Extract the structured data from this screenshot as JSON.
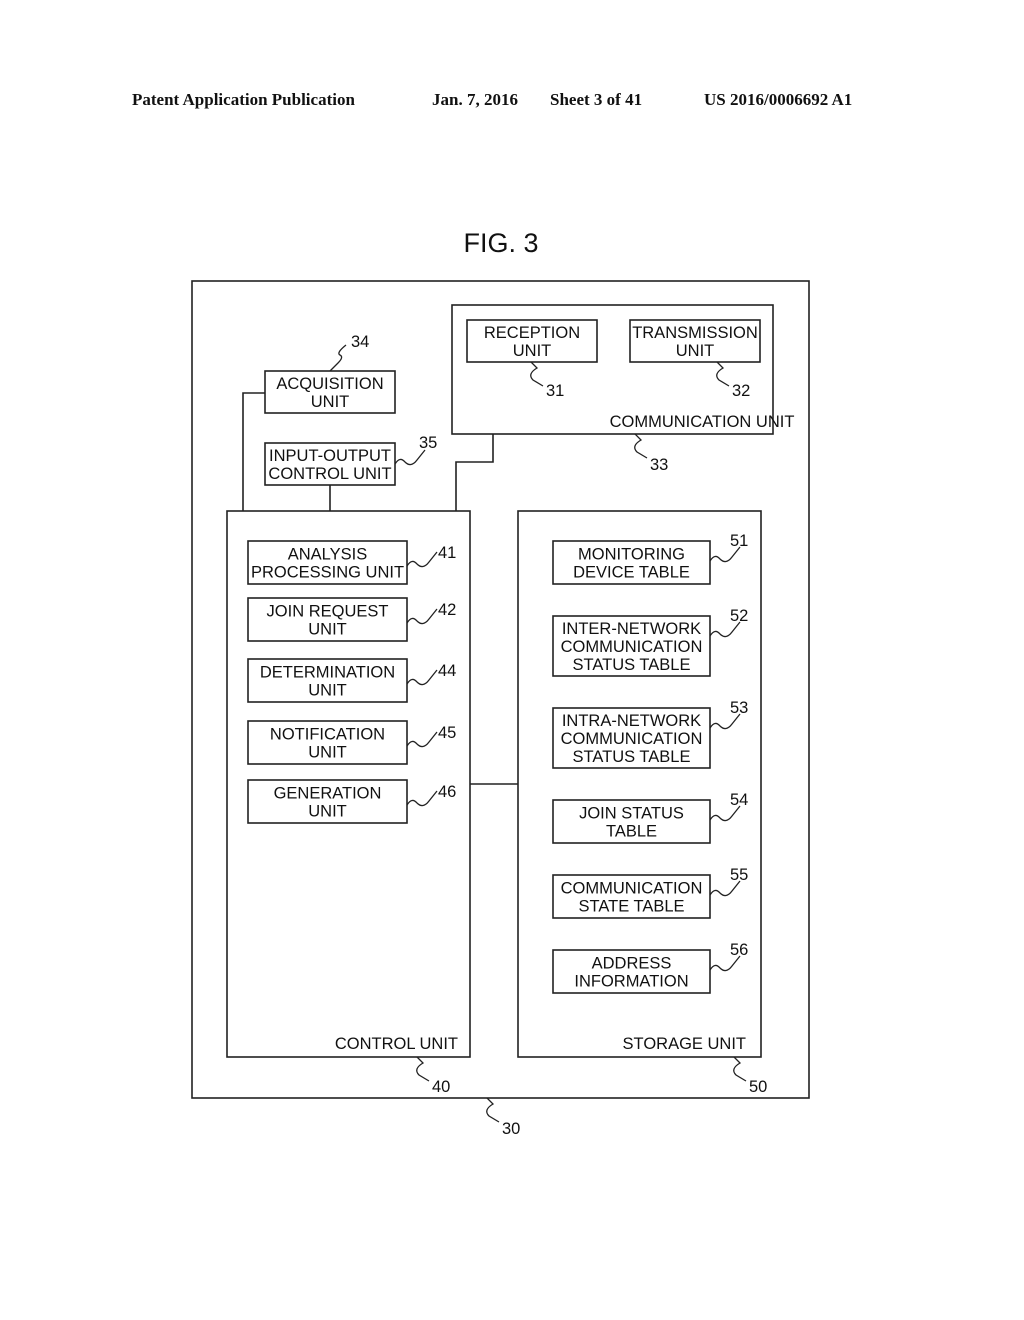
{
  "header": {
    "publication": "Patent Application Publication",
    "date": "Jan. 7, 2016",
    "sheet": "Sheet 3 of 41",
    "number": "US 2016/0006692 A1"
  },
  "figure": {
    "title": "FIG. 3",
    "device_ref": "30",
    "communication_unit": {
      "label": "COMMUNICATION UNIT",
      "ref": "33",
      "children": [
        {
          "lines": [
            "RECEPTION",
            "UNIT"
          ],
          "ref": "31"
        },
        {
          "lines": [
            "TRANSMISSION",
            "UNIT"
          ],
          "ref": "32"
        }
      ]
    },
    "acquisition_unit": {
      "lines": [
        "ACQUISITION",
        "UNIT"
      ],
      "ref": "34"
    },
    "io_control_unit": {
      "lines": [
        "INPUT-OUTPUT",
        "CONTROL UNIT"
      ],
      "ref": "35"
    },
    "control_unit": {
      "label": "CONTROL UNIT",
      "ref": "40",
      "children": [
        {
          "lines": [
            "ANALYSIS",
            "PROCESSING UNIT"
          ],
          "ref": "41"
        },
        {
          "lines": [
            "JOIN REQUEST",
            "UNIT"
          ],
          "ref": "42"
        },
        {
          "lines": [
            "DETERMINATION",
            "UNIT"
          ],
          "ref": "44"
        },
        {
          "lines": [
            "NOTIFICATION",
            "UNIT"
          ],
          "ref": "45"
        },
        {
          "lines": [
            "GENERATION",
            "UNIT"
          ],
          "ref": "46"
        }
      ]
    },
    "storage_unit": {
      "label": "STORAGE UNIT",
      "ref": "50",
      "children": [
        {
          "lines": [
            "MONITORING",
            "DEVICE TABLE"
          ],
          "ref": "51"
        },
        {
          "lines": [
            "INTER-NETWORK",
            "COMMUNICATION",
            "STATUS TABLE"
          ],
          "ref": "52"
        },
        {
          "lines": [
            "INTRA-NETWORK",
            "COMMUNICATION",
            "STATUS TABLE"
          ],
          "ref": "53"
        },
        {
          "lines": [
            "JOIN STATUS",
            "TABLE"
          ],
          "ref": "54"
        },
        {
          "lines": [
            "COMMUNICATION",
            "STATE TABLE"
          ],
          "ref": "55"
        },
        {
          "lines": [
            "ADDRESS",
            "INFORMATION"
          ],
          "ref": "56"
        }
      ]
    }
  }
}
